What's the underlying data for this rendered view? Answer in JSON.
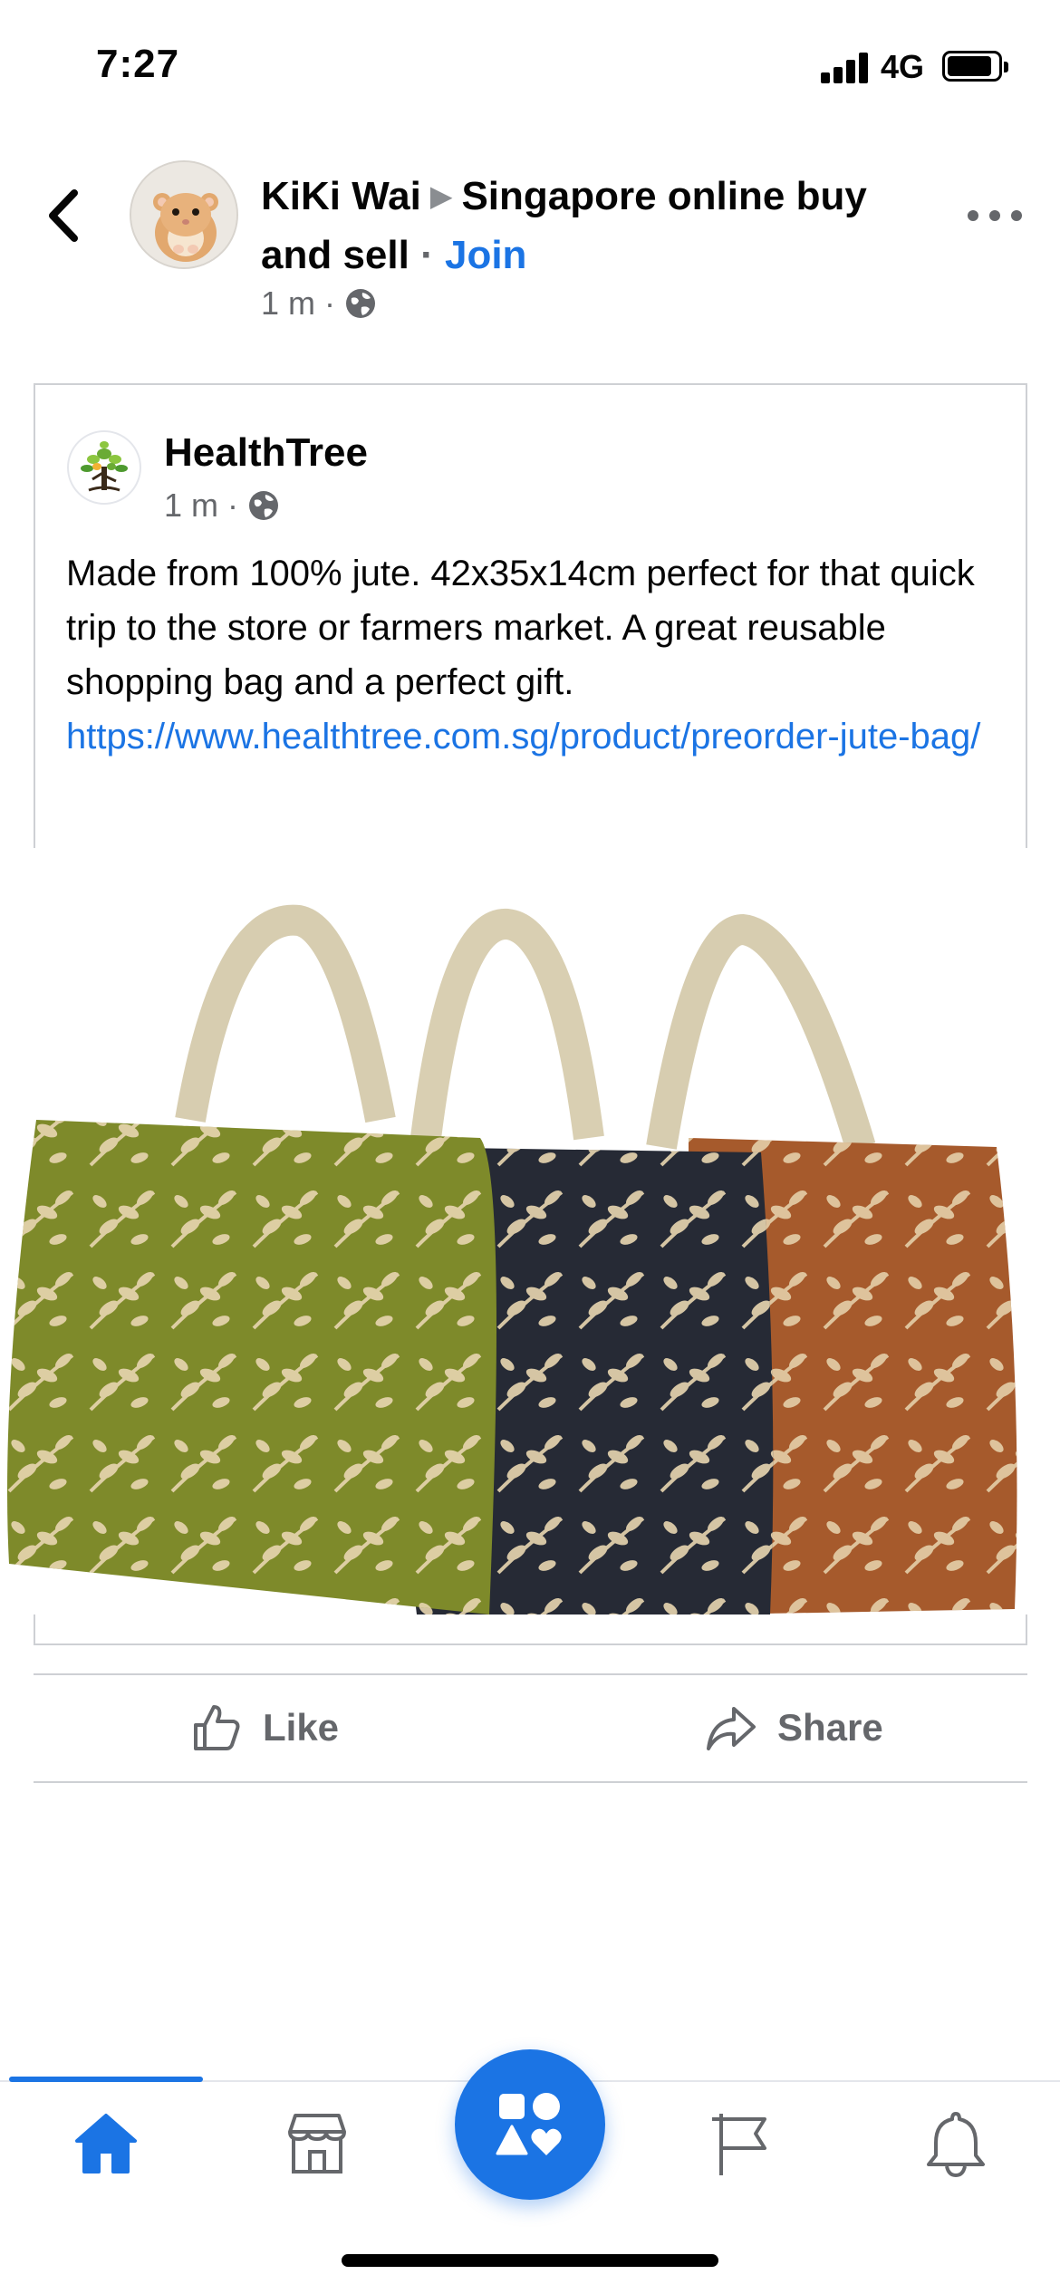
{
  "status_bar": {
    "time": "7:27",
    "network": "4G",
    "signal_bars": 4,
    "battery_level": 0.85
  },
  "header": {
    "author": "KiKi Wai",
    "group": "Singapore online buy and sell",
    "separator": "·",
    "join_label": "Join",
    "timestamp": "1 m",
    "dot": "·",
    "privacy_icon": "globe-icon",
    "back_icon": "chevron-left-icon",
    "more_icon": "more-horizontal-icon"
  },
  "shared_post": {
    "page_name": "HealthTree",
    "timestamp": "1 m",
    "dot": "·",
    "privacy_icon": "globe-icon",
    "text": "Made from 100% jute. 42x35x14cm perfect for that quick trip to the store or farmers market. A great reusable shopping bag and a perfect gift.",
    "link": "https://www.healthtree.com.sg/product/preorder-jute-bag/",
    "photo": "three printed jute tote bags"
  },
  "actions": {
    "like_label": "Like",
    "share_label": "Share"
  },
  "bottom_nav": {
    "items": [
      "home-icon",
      "marketplace-icon",
      "menu-shapes-icon",
      "pages-flag-icon",
      "notifications-bell-icon"
    ],
    "active": "home-icon"
  },
  "colors": {
    "accent": "#1b74e4",
    "secondary_text": "#65676b",
    "divider": "#ced0d4",
    "bag_green": "#7e8a2a",
    "bag_navy": "#262a35",
    "bag_brown": "#a65a2c"
  }
}
